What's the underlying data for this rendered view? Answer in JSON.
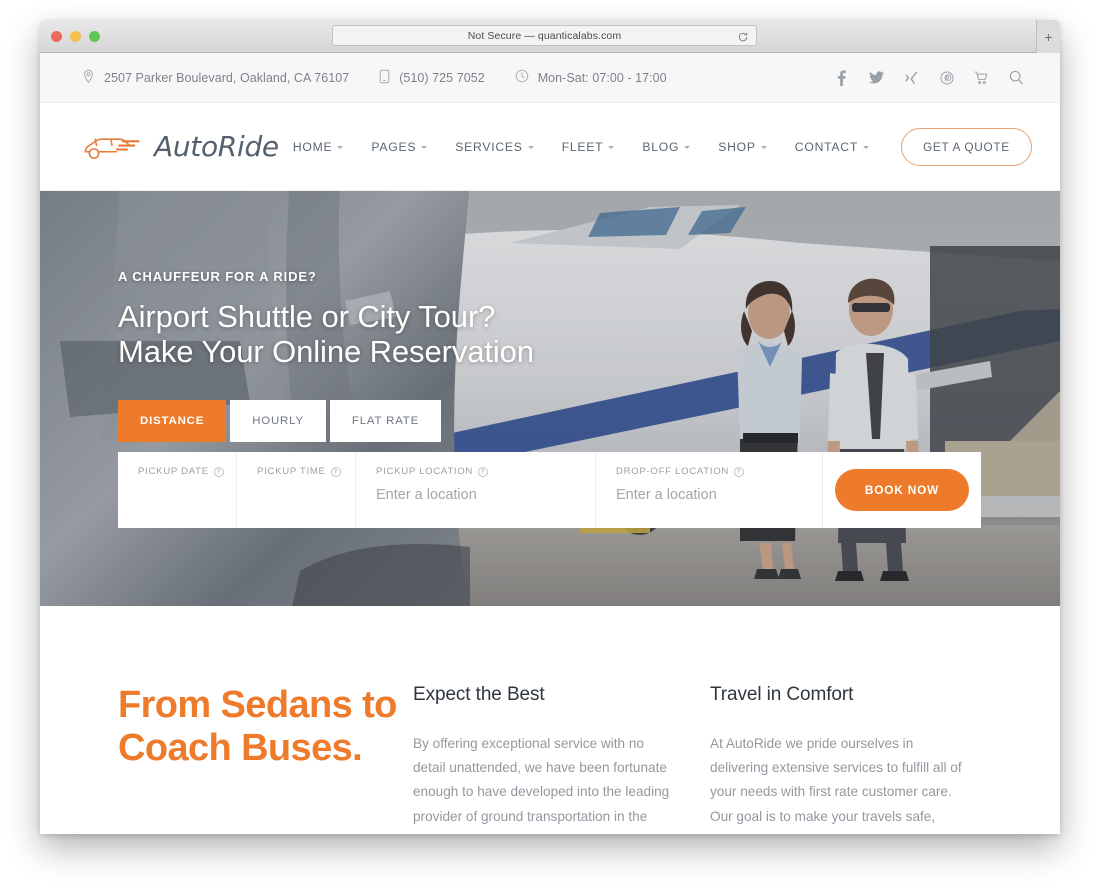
{
  "browser": {
    "url_text": "Not Secure — quanticalabs.com",
    "reload_label": "⟳",
    "new_tab_label": "+",
    "traffic_lights": [
      "close",
      "minimize",
      "zoom"
    ]
  },
  "topbar": {
    "address": "2507 Parker Boulevard, Oakland, CA 76107",
    "phone": "(510) 725 7052",
    "hours": "Mon-Sat: 07:00 - 17:00",
    "social": [
      {
        "name": "facebook-icon",
        "glyph": "f"
      },
      {
        "name": "twitter-icon",
        "glyph": "t"
      },
      {
        "name": "xing-icon",
        "glyph": "x"
      },
      {
        "name": "pinterest-icon",
        "glyph": "p"
      },
      {
        "name": "cart-icon",
        "glyph": "c"
      },
      {
        "name": "search-icon",
        "glyph": "s"
      }
    ]
  },
  "header": {
    "brand": "AutoRide",
    "nav": [
      {
        "label": "HOME",
        "has_caret": true
      },
      {
        "label": "PAGES",
        "has_caret": true
      },
      {
        "label": "SERVICES",
        "has_caret": true
      },
      {
        "label": "FLEET",
        "has_caret": true
      },
      {
        "label": "BLOG",
        "has_caret": true
      },
      {
        "label": "SHOP",
        "has_caret": true
      },
      {
        "label": "CONTACT",
        "has_caret": true
      }
    ],
    "quote_button": "GET A QUOTE"
  },
  "hero": {
    "kicker": "A CHAUFFEUR FOR A RIDE?",
    "title_line1": "Airport Shuttle or City Tour?",
    "title_line2": "Make Your Online Reservation",
    "tabs": [
      {
        "label": "DISTANCE",
        "active": true
      },
      {
        "label": "HOURLY",
        "active": false
      },
      {
        "label": "FLAT RATE",
        "active": false
      }
    ],
    "booking": {
      "pickup_date_label": "PICKUP DATE",
      "pickup_date_value": "",
      "pickup_time_label": "PICKUP TIME",
      "pickup_time_value": "",
      "pickup_location_label": "PICKUP LOCATION",
      "pickup_location_placeholder": "Enter a location",
      "dropoff_location_label": "DROP-OFF LOCATION",
      "dropoff_location_placeholder": "Enter a location",
      "book_button": "BOOK NOW",
      "help_glyph": "?"
    }
  },
  "features": {
    "headline": "From Sedans to Coach Buses.",
    "columns": [
      {
        "title": "Expect the Best",
        "body": "By offering exceptional service with no detail unattended, we have been fortunate enough to have developed into the leading provider of ground transportation in the area."
      },
      {
        "title": "Travel in Comfort",
        "body": "At AutoRide we pride ourselves in delivering extensive services to fulfill all of your needs with first rate customer care. Our goal is to make your travels safe, effortless and on schedule."
      }
    ]
  },
  "colors": {
    "accent_orange": "#ee7a2b",
    "topbar_bg": "#f7f7f7",
    "text_dark": "#2f3640",
    "text_muted": "#9398a0"
  }
}
